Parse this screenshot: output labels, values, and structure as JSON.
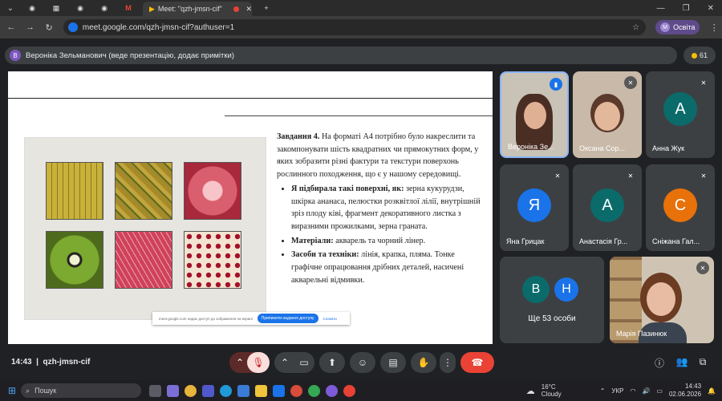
{
  "browser": {
    "active_tab_title": "Meet: \"qzh-jmsn-cif\"",
    "url": "meet.google.com/qzh-jmsn-cif?authuser=1",
    "profile_initial": "M",
    "profile_name": "Освіта"
  },
  "meet": {
    "presenter_initial": "В",
    "presenter_text": "Вероніка Зельманович (веде презентацію, додає примітки)",
    "participant_count": "61",
    "time": "14:43",
    "meeting_code": "qzh-jmsn-cif"
  },
  "slide": {
    "task_title": "Завдання 4.",
    "task_text": "На форматі А4 потрібно було накреслити та закомпонувати шість квадратних чи прямокутних форм, у яких зобразити різні фактури та текстури поверхонь рослинного походження, що є у нашому середовищі.",
    "bullet1_bold": "Я підбирала такі поверхні, як:",
    "bullet1_text": "зерна кукурудзи, шкірка ананаса, пелюстки розквітлої лілії, внутрішній зріз плоду ківі, фрагмент декоративного листка з виразними прожилками, зерна граната.",
    "bullet2_bold": "Матеріали:",
    "bullet2_text": "акварель та чорний лінер.",
    "bullet3_bold": "Засоби та техніки:",
    "bullet3_text": "лінія, крапка, пляма. Тонке графічне опрацювання дрібних деталей, насичені акварельні відмивки."
  },
  "share_bar": {
    "text": "meet.google.com надає доступ до зображення на екрані",
    "button": "Припинити надання доступу",
    "hide": "Сховати"
  },
  "participants": [
    {
      "name": "Вероніка Зе...",
      "initial": ""
    },
    {
      "name": "Оксана Сор...",
      "initial": ""
    },
    {
      "name": "Анна Жук",
      "initial": "А",
      "color": "#0b6b6b"
    },
    {
      "name": "Яна Грицак",
      "initial": "Я",
      "color": "#1a73e8"
    },
    {
      "name": "Анастасія Гр...",
      "initial": "А",
      "color": "#0b6b6b"
    },
    {
      "name": "Сніжана Гал...",
      "initial": "С",
      "color": "#e8710a"
    },
    {
      "name": "Марія Пазинюк",
      "initial": ""
    }
  ],
  "others": {
    "a": "В",
    "b": "Н",
    "label": "Ще 53 особи"
  },
  "taskbar": {
    "search": "Пошук",
    "weather_temp": "16°C",
    "weather_text": "Cloudy",
    "lang": "УКР",
    "clock_time": "14:43",
    "clock_date": "02.06.2026"
  }
}
